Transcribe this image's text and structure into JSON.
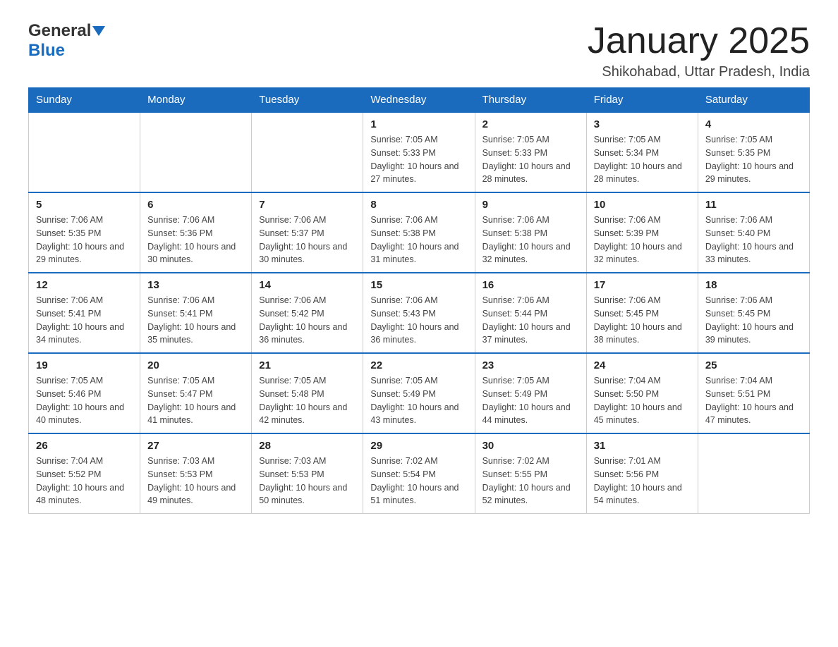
{
  "header": {
    "month_title": "January 2025",
    "location": "Shikohabad, Uttar Pradesh, India",
    "logo_general": "General",
    "logo_blue": "Blue"
  },
  "calendar": {
    "days_of_week": [
      "Sunday",
      "Monday",
      "Tuesday",
      "Wednesday",
      "Thursday",
      "Friday",
      "Saturday"
    ],
    "weeks": [
      {
        "days": [
          {
            "number": "",
            "info": ""
          },
          {
            "number": "",
            "info": ""
          },
          {
            "number": "",
            "info": ""
          },
          {
            "number": "1",
            "info": "Sunrise: 7:05 AM\nSunset: 5:33 PM\nDaylight: 10 hours\nand 27 minutes."
          },
          {
            "number": "2",
            "info": "Sunrise: 7:05 AM\nSunset: 5:33 PM\nDaylight: 10 hours\nand 28 minutes."
          },
          {
            "number": "3",
            "info": "Sunrise: 7:05 AM\nSunset: 5:34 PM\nDaylight: 10 hours\nand 28 minutes."
          },
          {
            "number": "4",
            "info": "Sunrise: 7:05 AM\nSunset: 5:35 PM\nDaylight: 10 hours\nand 29 minutes."
          }
        ]
      },
      {
        "days": [
          {
            "number": "5",
            "info": "Sunrise: 7:06 AM\nSunset: 5:35 PM\nDaylight: 10 hours\nand 29 minutes."
          },
          {
            "number": "6",
            "info": "Sunrise: 7:06 AM\nSunset: 5:36 PM\nDaylight: 10 hours\nand 30 minutes."
          },
          {
            "number": "7",
            "info": "Sunrise: 7:06 AM\nSunset: 5:37 PM\nDaylight: 10 hours\nand 30 minutes."
          },
          {
            "number": "8",
            "info": "Sunrise: 7:06 AM\nSunset: 5:38 PM\nDaylight: 10 hours\nand 31 minutes."
          },
          {
            "number": "9",
            "info": "Sunrise: 7:06 AM\nSunset: 5:38 PM\nDaylight: 10 hours\nand 32 minutes."
          },
          {
            "number": "10",
            "info": "Sunrise: 7:06 AM\nSunset: 5:39 PM\nDaylight: 10 hours\nand 32 minutes."
          },
          {
            "number": "11",
            "info": "Sunrise: 7:06 AM\nSunset: 5:40 PM\nDaylight: 10 hours\nand 33 minutes."
          }
        ]
      },
      {
        "days": [
          {
            "number": "12",
            "info": "Sunrise: 7:06 AM\nSunset: 5:41 PM\nDaylight: 10 hours\nand 34 minutes."
          },
          {
            "number": "13",
            "info": "Sunrise: 7:06 AM\nSunset: 5:41 PM\nDaylight: 10 hours\nand 35 minutes."
          },
          {
            "number": "14",
            "info": "Sunrise: 7:06 AM\nSunset: 5:42 PM\nDaylight: 10 hours\nand 36 minutes."
          },
          {
            "number": "15",
            "info": "Sunrise: 7:06 AM\nSunset: 5:43 PM\nDaylight: 10 hours\nand 36 minutes."
          },
          {
            "number": "16",
            "info": "Sunrise: 7:06 AM\nSunset: 5:44 PM\nDaylight: 10 hours\nand 37 minutes."
          },
          {
            "number": "17",
            "info": "Sunrise: 7:06 AM\nSunset: 5:45 PM\nDaylight: 10 hours\nand 38 minutes."
          },
          {
            "number": "18",
            "info": "Sunrise: 7:06 AM\nSunset: 5:45 PM\nDaylight: 10 hours\nand 39 minutes."
          }
        ]
      },
      {
        "days": [
          {
            "number": "19",
            "info": "Sunrise: 7:05 AM\nSunset: 5:46 PM\nDaylight: 10 hours\nand 40 minutes."
          },
          {
            "number": "20",
            "info": "Sunrise: 7:05 AM\nSunset: 5:47 PM\nDaylight: 10 hours\nand 41 minutes."
          },
          {
            "number": "21",
            "info": "Sunrise: 7:05 AM\nSunset: 5:48 PM\nDaylight: 10 hours\nand 42 minutes."
          },
          {
            "number": "22",
            "info": "Sunrise: 7:05 AM\nSunset: 5:49 PM\nDaylight: 10 hours\nand 43 minutes."
          },
          {
            "number": "23",
            "info": "Sunrise: 7:05 AM\nSunset: 5:49 PM\nDaylight: 10 hours\nand 44 minutes."
          },
          {
            "number": "24",
            "info": "Sunrise: 7:04 AM\nSunset: 5:50 PM\nDaylight: 10 hours\nand 45 minutes."
          },
          {
            "number": "25",
            "info": "Sunrise: 7:04 AM\nSunset: 5:51 PM\nDaylight: 10 hours\nand 47 minutes."
          }
        ]
      },
      {
        "days": [
          {
            "number": "26",
            "info": "Sunrise: 7:04 AM\nSunset: 5:52 PM\nDaylight: 10 hours\nand 48 minutes."
          },
          {
            "number": "27",
            "info": "Sunrise: 7:03 AM\nSunset: 5:53 PM\nDaylight: 10 hours\nand 49 minutes."
          },
          {
            "number": "28",
            "info": "Sunrise: 7:03 AM\nSunset: 5:53 PM\nDaylight: 10 hours\nand 50 minutes."
          },
          {
            "number": "29",
            "info": "Sunrise: 7:02 AM\nSunset: 5:54 PM\nDaylight: 10 hours\nand 51 minutes."
          },
          {
            "number": "30",
            "info": "Sunrise: 7:02 AM\nSunset: 5:55 PM\nDaylight: 10 hours\nand 52 minutes."
          },
          {
            "number": "31",
            "info": "Sunrise: 7:01 AM\nSunset: 5:56 PM\nDaylight: 10 hours\nand 54 minutes."
          },
          {
            "number": "",
            "info": ""
          }
        ]
      }
    ]
  }
}
